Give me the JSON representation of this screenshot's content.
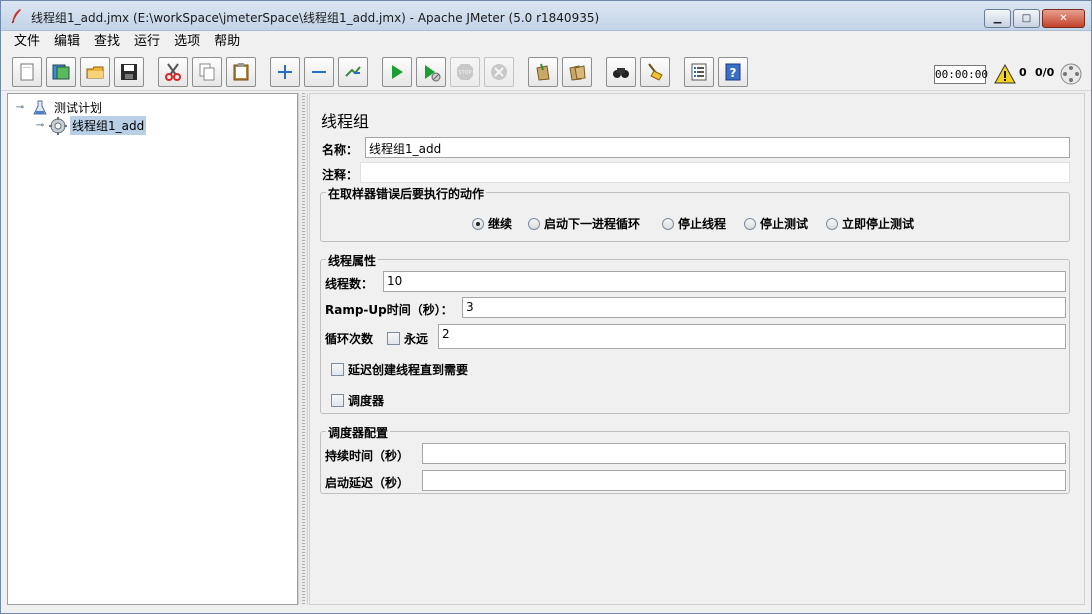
{
  "window": {
    "title": "线程组1_add.jmx (E:\\workSpace\\jmeterSpace\\线程组1_add.jmx) - Apache JMeter (5.0 r1840935)",
    "minimize_label": "▁",
    "maximize_label": "□",
    "close_label": "✕"
  },
  "menu": {
    "items": [
      "文件",
      "编辑",
      "查找",
      "运行",
      "选项",
      "帮助"
    ]
  },
  "toolbar": {
    "buttons": [
      "new-icon",
      "templates-icon",
      "open-icon",
      "save-icon",
      "cut-icon",
      "copy-icon",
      "paste-icon",
      "expand-icon",
      "collapse-icon",
      "toggle-icon",
      "start-icon",
      "start-no-pause-icon",
      "stop-icon",
      "shutdown-icon",
      "clear-icon",
      "clear-all-icon",
      "search-icon",
      "reset-search-icon",
      "function-helper-icon",
      "help-icon"
    ],
    "timer": "00:00:00",
    "warning_count": "0",
    "threads": "0/0"
  },
  "tree": {
    "root_label": "测试计划",
    "child_label": "线程组1_add"
  },
  "panel": {
    "title": "线程组",
    "name_label": "名称：",
    "name_value": "线程组1_add",
    "comment_label": "注释：",
    "comment_value": "",
    "error_action": {
      "title": "在取样器错误后要执行的动作",
      "options": [
        "继续",
        "启动下一进程循环",
        "停止线程",
        "停止测试",
        "立即停止测试"
      ],
      "selected": "继续"
    },
    "thread_props": {
      "title": "线程属性",
      "threads_label": "线程数：",
      "threads_value": "10",
      "rampup_label": "Ramp-Up时间（秒）：",
      "rampup_value": "3",
      "loop_label": "循环次数",
      "forever_label": "永远",
      "forever_checked": false,
      "loop_value": "2",
      "delay_label": "延迟创建线程直到需要",
      "delay_checked": false,
      "scheduler_label": "调度器",
      "scheduler_checked": false
    },
    "scheduler_config": {
      "title": "调度器配置",
      "duration_label": "持续时间（秒）",
      "duration_value": "",
      "startup_delay_label": "启动延迟（秒）",
      "startup_delay_value": ""
    }
  },
  "colors": {
    "title_bg": "#c3d4e8",
    "selection": "#b8cfe5",
    "start_green": "#1e9e2f",
    "warning_yellow": "#f2d21a"
  }
}
